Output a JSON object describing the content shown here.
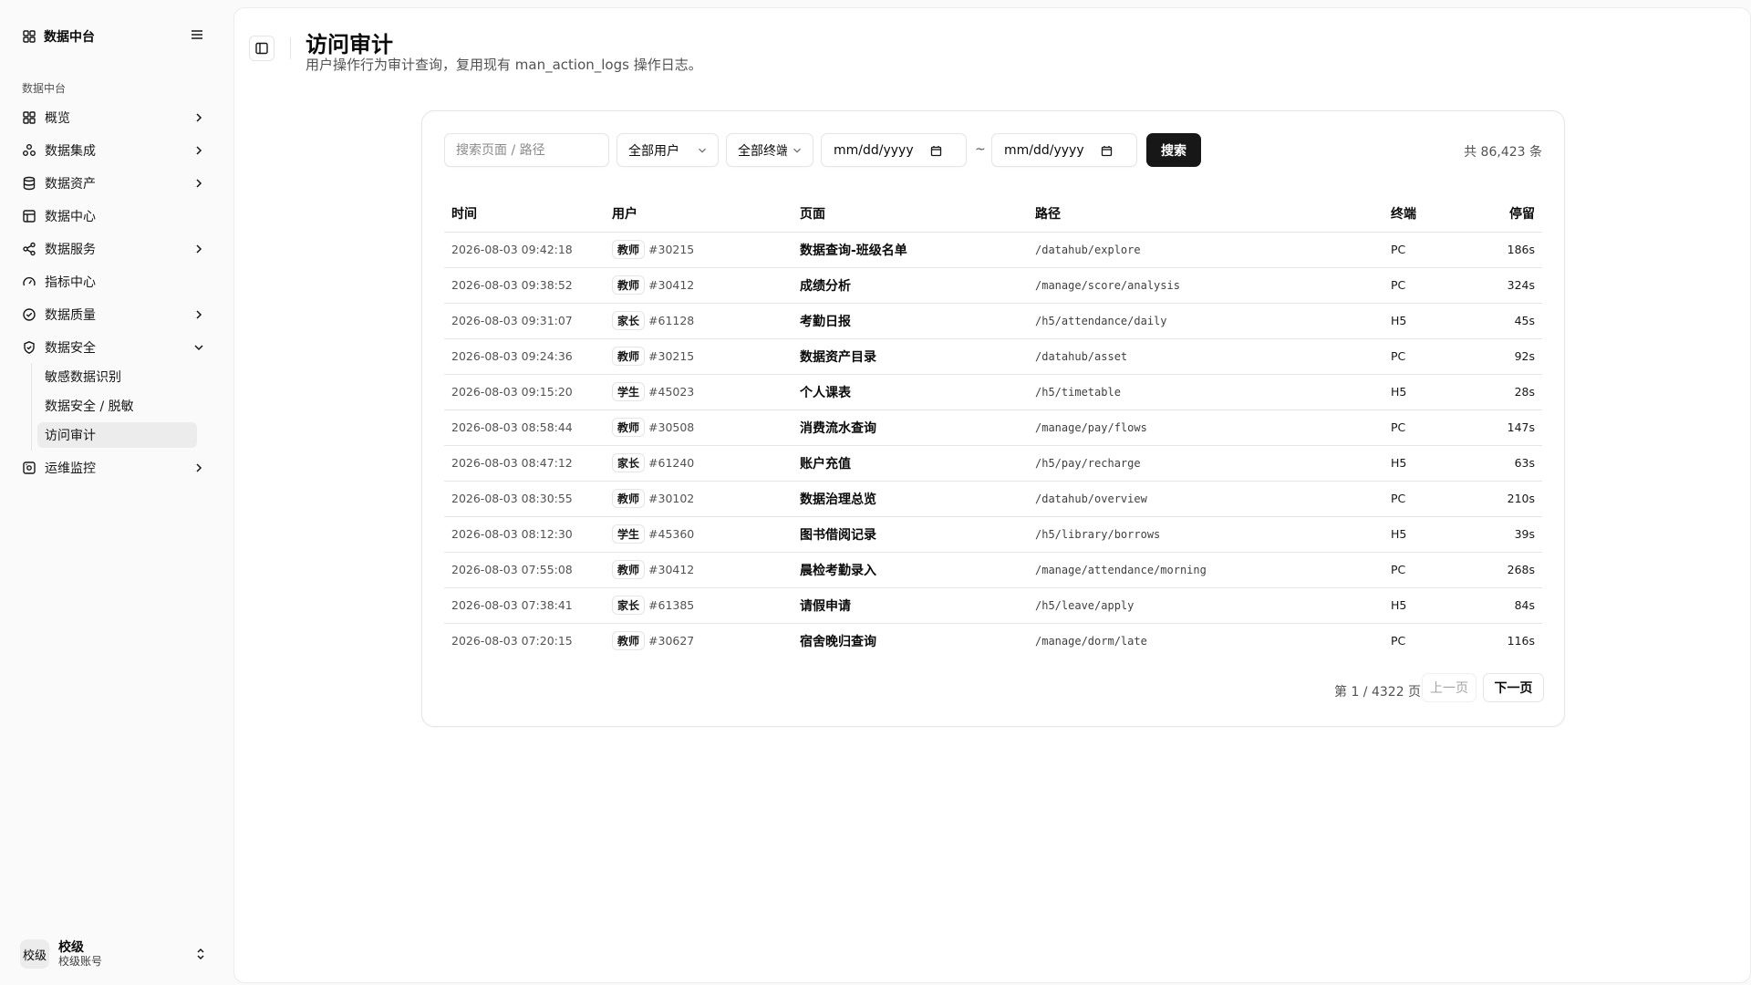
{
  "sidebar": {
    "brand": "数据中台",
    "group_label": "数据中台",
    "items": [
      {
        "label": "概览",
        "icon": "grid-icon"
      },
      {
        "label": "数据集成",
        "icon": "integration-icon"
      },
      {
        "label": "数据资产",
        "icon": "database-icon"
      },
      {
        "label": "数据中心",
        "icon": "table-icon"
      },
      {
        "label": "数据服务",
        "icon": "share-icon"
      },
      {
        "label": "指标中心",
        "icon": "gauge-icon"
      },
      {
        "label": "数据质量",
        "icon": "check-circle-icon"
      },
      {
        "label": "数据安全",
        "icon": "shield-icon"
      },
      {
        "label": "运维监控",
        "icon": "monitor-icon"
      }
    ],
    "sub_items": [
      "敏感数据识别",
      "数据安全 / 脱敏",
      "访问审计"
    ],
    "user": {
      "avatar": "校级",
      "name": "校级",
      "role": "校级账号"
    }
  },
  "header": {
    "title": "访问审计",
    "subtitle": "用户操作行为审计查询，复用现有 man_action_logs 操作日志。"
  },
  "filters": {
    "search_placeholder": "搜索页面 / 路径",
    "user_select": "全部用户",
    "terminal_select": "全部终端",
    "date_from": "mm/dd/yyyy",
    "date_sep": "~",
    "date_to": "mm/dd/yyyy",
    "search_button": "搜索",
    "total": "共 86,423 条"
  },
  "table": {
    "columns": [
      "时间",
      "用户",
      "页面",
      "路径",
      "终端",
      "停留"
    ],
    "rows": [
      {
        "time": "2026-08-03 09:42:18",
        "role": "教师",
        "uid": "#30215",
        "page": "数据查询-班级名单",
        "path": "/datahub/explore",
        "terminal": "PC",
        "stay": "186s"
      },
      {
        "time": "2026-08-03 09:38:52",
        "role": "教师",
        "uid": "#30412",
        "page": "成绩分析",
        "path": "/manage/score/analysis",
        "terminal": "PC",
        "stay": "324s"
      },
      {
        "time": "2026-08-03 09:31:07",
        "role": "家长",
        "uid": "#61128",
        "page": "考勤日报",
        "path": "/h5/attendance/daily",
        "terminal": "H5",
        "stay": "45s"
      },
      {
        "time": "2026-08-03 09:24:36",
        "role": "教师",
        "uid": "#30215",
        "page": "数据资产目录",
        "path": "/datahub/asset",
        "terminal": "PC",
        "stay": "92s"
      },
      {
        "time": "2026-08-03 09:15:20",
        "role": "学生",
        "uid": "#45023",
        "page": "个人课表",
        "path": "/h5/timetable",
        "terminal": "H5",
        "stay": "28s"
      },
      {
        "time": "2026-08-03 08:58:44",
        "role": "教师",
        "uid": "#30508",
        "page": "消费流水查询",
        "path": "/manage/pay/flows",
        "terminal": "PC",
        "stay": "147s"
      },
      {
        "time": "2026-08-03 08:47:12",
        "role": "家长",
        "uid": "#61240",
        "page": "账户充值",
        "path": "/h5/pay/recharge",
        "terminal": "H5",
        "stay": "63s"
      },
      {
        "time": "2026-08-03 08:30:55",
        "role": "教师",
        "uid": "#30102",
        "page": "数据治理总览",
        "path": "/datahub/overview",
        "terminal": "PC",
        "stay": "210s"
      },
      {
        "time": "2026-08-03 08:12:30",
        "role": "学生",
        "uid": "#45360",
        "page": "图书借阅记录",
        "path": "/h5/library/borrows",
        "terminal": "H5",
        "stay": "39s"
      },
      {
        "time": "2026-08-03 07:55:08",
        "role": "教师",
        "uid": "#30412",
        "page": "晨检考勤录入",
        "path": "/manage/attendance/morning",
        "terminal": "PC",
        "stay": "268s"
      },
      {
        "time": "2026-08-03 07:38:41",
        "role": "家长",
        "uid": "#61385",
        "page": "请假申请",
        "path": "/h5/leave/apply",
        "terminal": "H5",
        "stay": "84s"
      },
      {
        "time": "2026-08-03 07:20:15",
        "role": "教师",
        "uid": "#30627",
        "page": "宿舍晚归查询",
        "path": "/manage/dorm/late",
        "terminal": "PC",
        "stay": "116s"
      }
    ]
  },
  "pagination": {
    "info": "第 1 / 4322 页",
    "prev": "上一页",
    "next": "下一页"
  }
}
